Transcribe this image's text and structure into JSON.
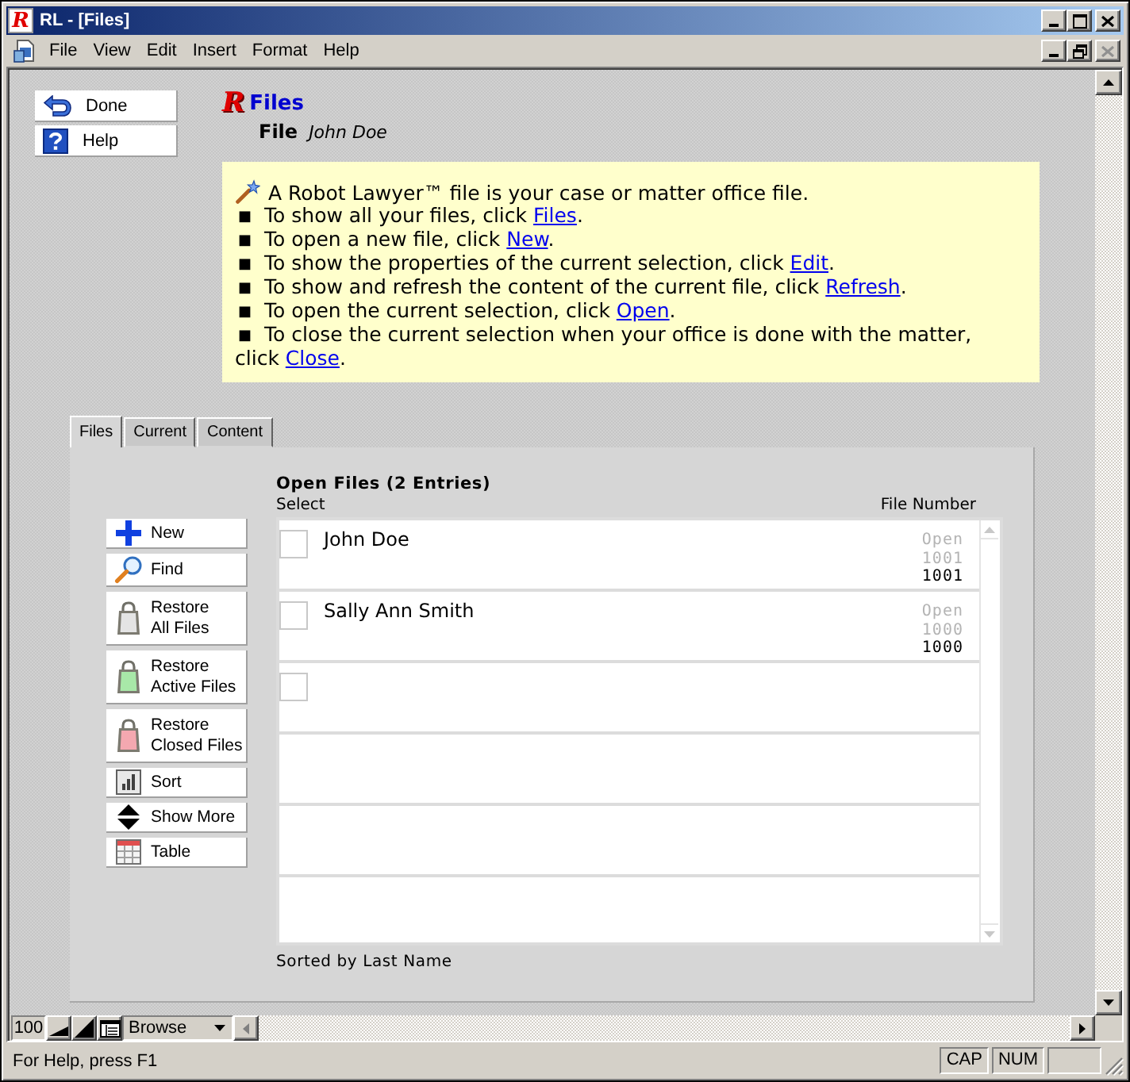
{
  "window": {
    "title": "RL - [Files]",
    "logo": "R"
  },
  "menu_bar": {
    "items": [
      "File",
      "View",
      "Edit",
      "Insert",
      "Format",
      "Help"
    ]
  },
  "nav_buttons": [
    {
      "label": "Done",
      "kind": "back"
    },
    {
      "label": "Help",
      "kind": "help"
    }
  ],
  "header": {
    "logo": "R",
    "title": "Files",
    "field_label": "File",
    "field_value": "John Doe"
  },
  "info_box": {
    "intro": "A Robot Lawyer™ file is your case or matter office file.",
    "items": [
      {
        "bullet": "■",
        "before": "To show all your files, click ",
        "link": "Files",
        "after": "."
      },
      {
        "bullet": "■",
        "before": "To open a new file, click ",
        "link": "New",
        "after": "."
      },
      {
        "bullet": "■",
        "before": "To show the properties of the current selection, click ",
        "link": "Edit",
        "after": "."
      },
      {
        "bullet": "■",
        "before": "To show and refresh the content of the current file, click ",
        "link": "Refresh",
        "after": "."
      },
      {
        "bullet": "■",
        "before": "To open the current selection, click ",
        "link": "Open",
        "after": "."
      },
      {
        "bullet": "■",
        "before": "To close the current selection when your office is done with the matter, click ",
        "link": "Close",
        "after": "."
      }
    ]
  },
  "tabs": [
    {
      "label": "Files",
      "selected": true
    },
    {
      "label": "Current",
      "selected": false
    },
    {
      "label": "Content",
      "selected": false
    }
  ],
  "actions": [
    {
      "label": "New",
      "kind": "plus"
    },
    {
      "label": "Find",
      "kind": "search"
    },
    {
      "label": "Restore\nAll Files",
      "kind": "bag",
      "color": "#e4e4e4"
    },
    {
      "label": "Restore\nActive Files",
      "kind": "bag",
      "color": "#a8e8a8"
    },
    {
      "label": "Restore\nClosed Files",
      "kind": "bag",
      "color": "#f4a8b0"
    },
    {
      "label": "Sort",
      "kind": "chart"
    },
    {
      "label": "Show More",
      "kind": "updown"
    },
    {
      "label": "Table",
      "kind": "table"
    }
  ],
  "list": {
    "title": "Open Files (2 Entries)",
    "select_label": "Select",
    "number_label": "File Number",
    "rows": [
      {
        "checked": false,
        "name": "John Doe",
        "status_lines": [
          "Open",
          "1001"
        ],
        "file_number": "1001"
      },
      {
        "checked": false,
        "name": "Sally Ann Smith",
        "status_lines": [
          "Open",
          "1000"
        ],
        "file_number": "1000"
      },
      {
        "checked": false
      }
    ],
    "note": "Sorted by Last Name"
  },
  "bottom_bar": {
    "zoom": "100",
    "mode": "Browse"
  },
  "status_bar": {
    "message": "For Help, press F1",
    "indicators": [
      "CAP",
      "NUM"
    ]
  }
}
